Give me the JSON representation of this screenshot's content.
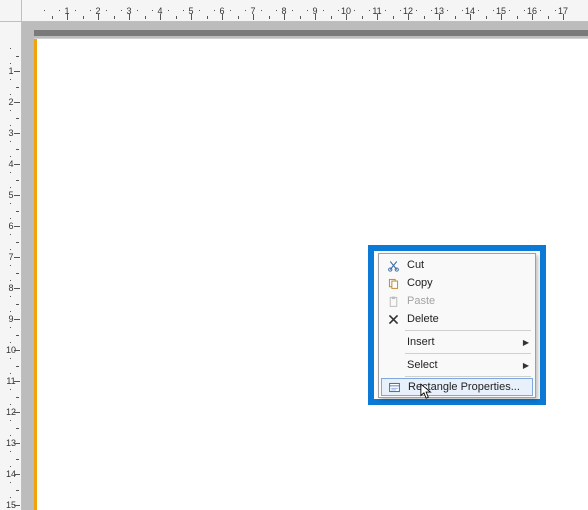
{
  "ruler": {
    "h_labels": [
      "1",
      "2",
      "3",
      "4",
      "5",
      "6",
      "7",
      "8",
      "9",
      "10",
      "11",
      "12",
      "13",
      "14",
      "15",
      "16",
      "17"
    ],
    "v_labels": [
      "1",
      "2",
      "3",
      "4",
      "5",
      "6",
      "7",
      "8",
      "9",
      "10",
      "11",
      "12",
      "13",
      "14",
      "15"
    ]
  },
  "context_menu": {
    "cut": "Cut",
    "copy": "Copy",
    "paste": "Paste",
    "delete": "Delete",
    "insert": "Insert",
    "select": "Select",
    "rect_props": "Rectangle Properties..."
  }
}
